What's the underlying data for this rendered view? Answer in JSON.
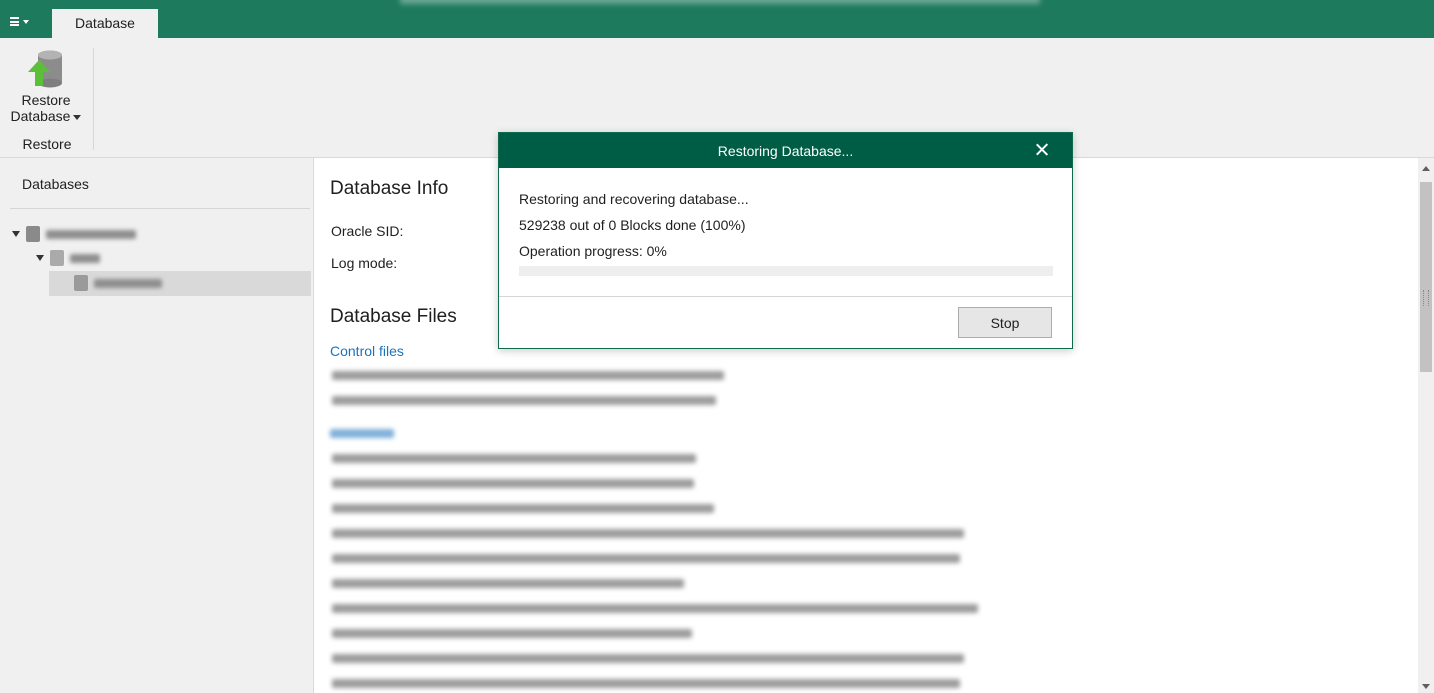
{
  "titlebar": {
    "tab_database": "Database",
    "bg": "#1d7a5c"
  },
  "ribbon": {
    "restore_line1": "Restore",
    "restore_line2": "Database",
    "group_label": "Restore"
  },
  "left_panel": {
    "title": "Databases"
  },
  "main": {
    "info_title": "Database Info",
    "oracle_sid_label": "Oracle SID:",
    "log_mode_label": "Log mode:",
    "files_title": "Database Files",
    "control_files_link": "Control files"
  },
  "dialog": {
    "title": "Restoring Database...",
    "status_line": "Restoring and recovering database...",
    "blocks_line": "529238 out of 0 Blocks done (100%)",
    "progress_label": "Operation progress:  0%",
    "progress_value": 0,
    "stop_button": "Stop",
    "header_color": "#005d45"
  }
}
